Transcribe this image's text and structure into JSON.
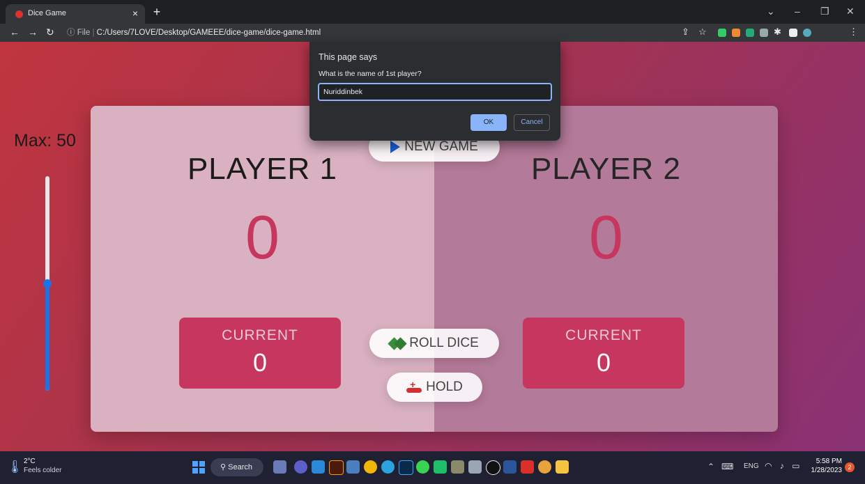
{
  "browser": {
    "tab_title": "Dice Game",
    "tab_close": "×",
    "new_tab": "+",
    "url_prefix": "File",
    "url_sep": "|",
    "url_path": "C:/Users/7LOVE/Desktop/GAMEEE/dice-game/dice-game.html"
  },
  "game": {
    "max_label": "Max: 50",
    "max_slider_fraction": 0.5,
    "player1": {
      "name": "PLAYER 1",
      "score": "0",
      "current_label": "CURRENT",
      "current": "0"
    },
    "player2": {
      "name": "PLAYER 2",
      "score": "0",
      "current_label": "CURRENT",
      "current": "0"
    },
    "buttons": {
      "new_game": "NEW GAME",
      "roll_dice": "ROLL DICE",
      "hold": "HOLD"
    }
  },
  "dialog": {
    "title": "This page says",
    "message": "What is the name of 1st player?",
    "input_value": "Nuriddinbek",
    "ok": "OK",
    "cancel": "Cancel"
  },
  "taskbar": {
    "weather_temp": "2°C",
    "weather_desc": "Feels colder",
    "search": "Search",
    "language": "ENG",
    "time": "5:58 PM",
    "date": "1/28/2023",
    "notifications": "2"
  },
  "colors": {
    "accent": "#c7365f",
    "bg_start": "#c0353f",
    "bg_end": "#8a3275",
    "dialog_button": "#8ab4f8"
  }
}
